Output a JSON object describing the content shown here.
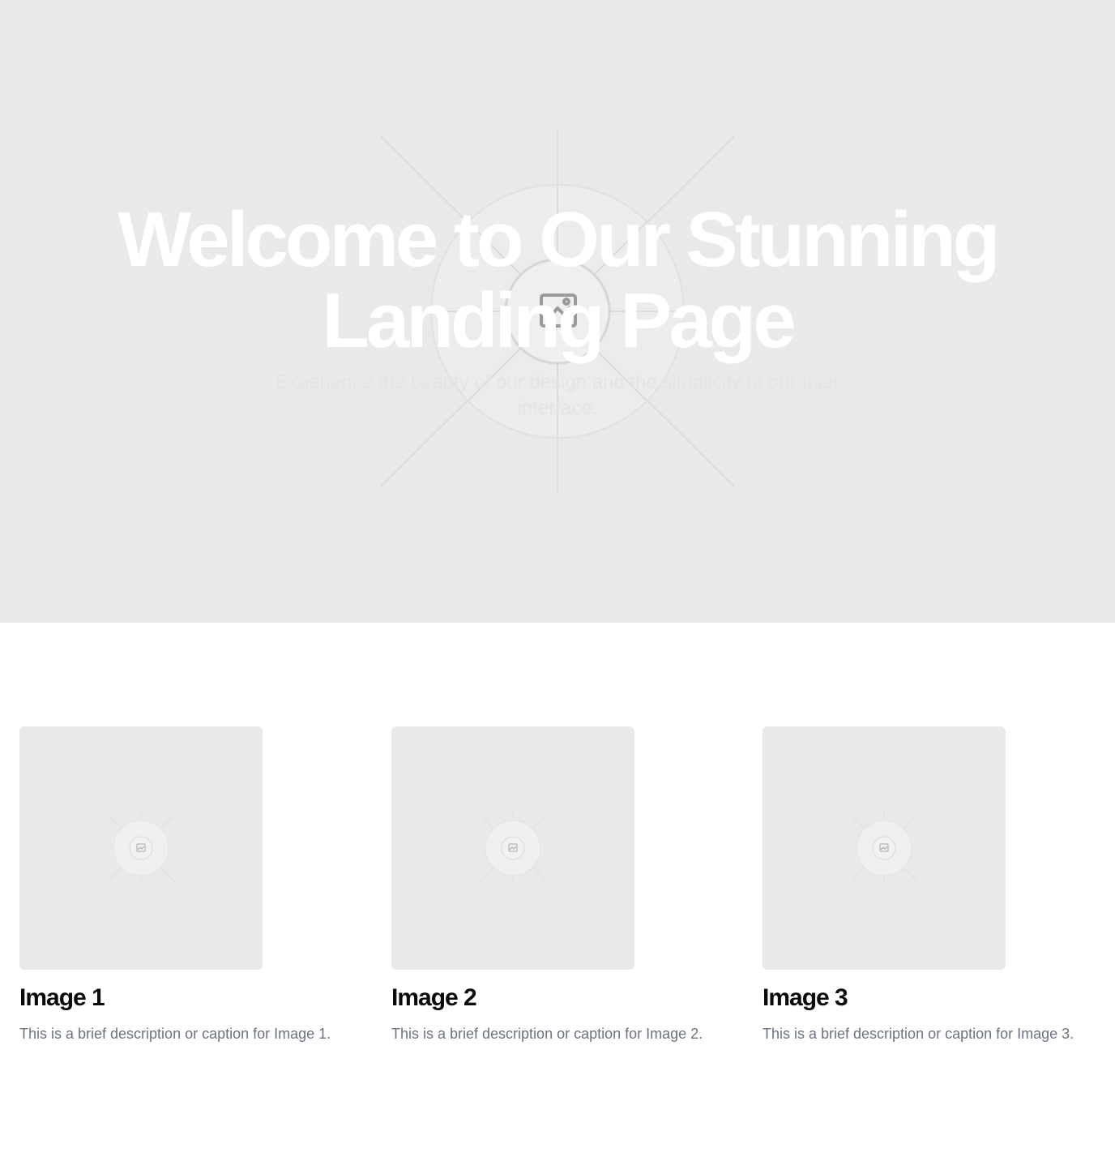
{
  "hero": {
    "title_line1": "Welcome to Our Stunning",
    "title_line2": "Landing Page",
    "subtitle": "Experience the beauty of our design and the simplicity of our user interface.",
    "background_icon": "image-placeholder-icon",
    "background_color": "#e9e9e9"
  },
  "gallery": {
    "items": [
      {
        "title": "Image 1",
        "description": "This is a brief description or caption for Image 1.",
        "icon": "image-placeholder-icon"
      },
      {
        "title": "Image 2",
        "description": "This is a brief description or caption for Image 2.",
        "icon": "image-placeholder-icon"
      },
      {
        "title": "Image 3",
        "description": "This is a brief description or caption for Image 3.",
        "icon": "image-placeholder-icon"
      }
    ]
  },
  "colors": {
    "placeholder_bg": "#e9e9e9",
    "heading": "#0b0b0b",
    "body_text": "#6b7280",
    "hero_title": "#ffffff"
  }
}
